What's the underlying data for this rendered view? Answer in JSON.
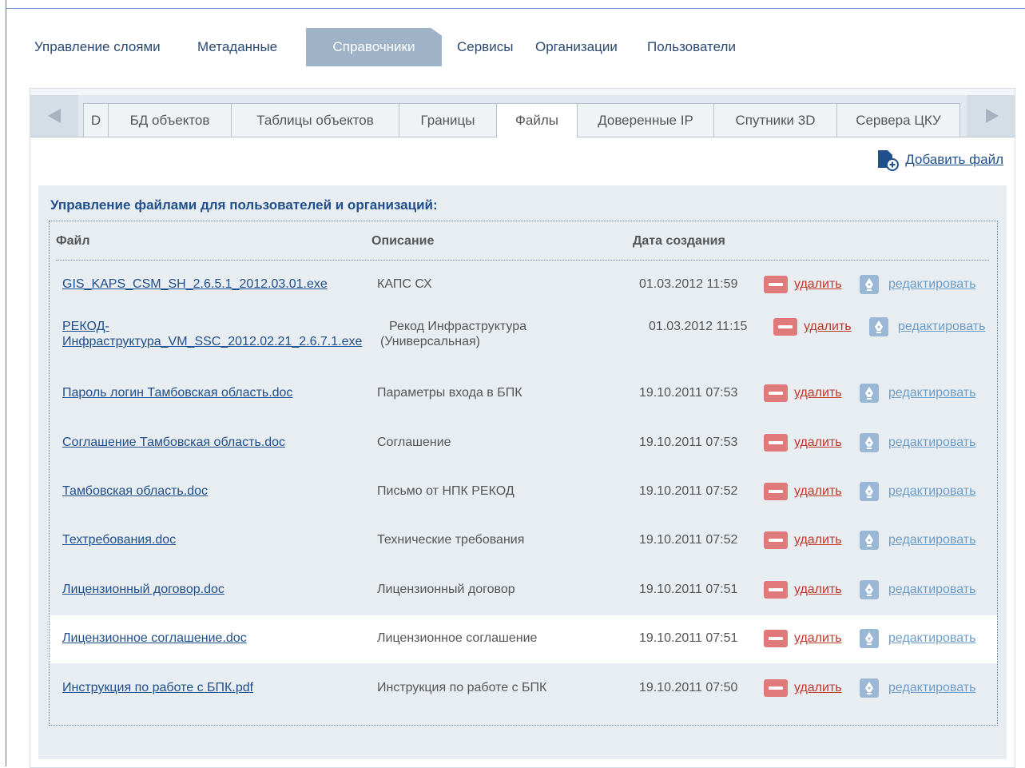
{
  "topnav": {
    "items": [
      "Управление слоями",
      "Метаданные",
      "Справочники",
      "Сервисы",
      "Организации",
      "Пользователи"
    ],
    "active": "Справочники"
  },
  "tabs": {
    "items": [
      "D",
      "БД объектов",
      "Таблицы объектов",
      "Границы",
      "Файлы",
      "Доверенные IP",
      "Спутники 3D",
      "Сервера ЦКУ"
    ],
    "active": "Файлы"
  },
  "add_file_label": "Добавить файл",
  "files": {
    "title": "Управление файлами для пользователей и организаций:",
    "columns": {
      "file": "Файл",
      "description": "Описание",
      "created": "Дата создания"
    },
    "delete_label": "удалить",
    "edit_label": "редактировать",
    "rows": [
      {
        "name": "GIS_KAPS_CSM_SH_2.6.5.1_2012.03.01.exe",
        "description": "КАПС СХ",
        "date": "01.03.2012 11:59"
      },
      {
        "name_line1": "РЕКОД-",
        "name_line2": "Инфраструктура_VM_SSC_2012.02.21_2.6.7.1.exe",
        "description_line1": "Рекод Инфраструктура",
        "description_line2": "(Универсальная)",
        "date": "01.03.2012 11:15"
      },
      {
        "name": "Пароль логин Тамбовская область.doc",
        "description": "Параметры входа в БПК",
        "date": "19.10.2011 07:53"
      },
      {
        "name": "Соглашение Тамбовская область.doc",
        "description": "Соглашение",
        "date": "19.10.2011 07:53"
      },
      {
        "name": "Тамбовская область.doc",
        "description": "Письмо от НПК РЕКОД",
        "date": "19.10.2011 07:52"
      },
      {
        "name": "Техтребования.doc",
        "description": "Технические требования",
        "date": "19.10.2011 07:52"
      },
      {
        "name": "Лицензионный договор.doc",
        "description": "Лицензионный договор",
        "date": "19.10.2011 07:51"
      },
      {
        "name": "Лицензионное соглашение.doc",
        "description": "Лицензионное соглашение",
        "date": "19.10.2011 07:51"
      },
      {
        "name": "Инструкция по работе с БПК.pdf",
        "description": "Инструкция по работе с БПК",
        "date": "19.10.2011 07:50"
      }
    ]
  }
}
